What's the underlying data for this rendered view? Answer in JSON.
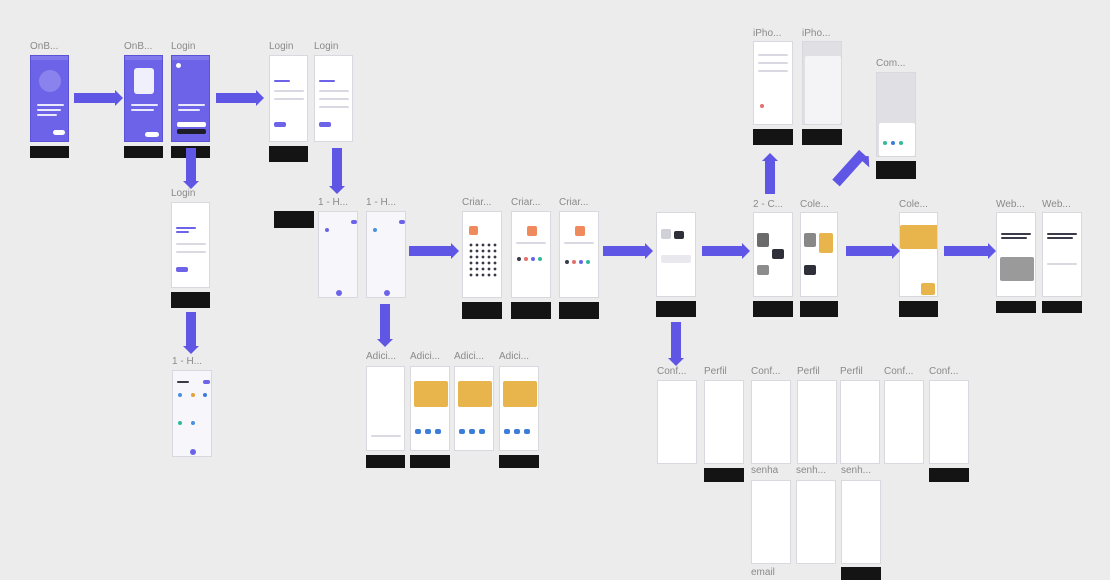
{
  "colors": {
    "background": "#ececec",
    "accent": "#6c63e9",
    "arrow": "#5f56e6",
    "note_bg": "#141414"
  },
  "frame_labels": {
    "onboarding_1": "OnB...",
    "onboarding_2": "OnB...",
    "login_1": "Login",
    "login_2": "Login",
    "login_3": "Login",
    "login_4": "Login",
    "home_a": "1 - H...",
    "home_b": "1 - H...",
    "home_c": "1 - H...",
    "criar_1": "Criar...",
    "criar_2": "Criar...",
    "criar_3": "Criar...",
    "adicionar_1": "Adici...",
    "adicionar_2": "Adici...",
    "adicionar_3": "Adici...",
    "adicionar_4": "Adici...",
    "iphone_1": "iPho...",
    "iphone_2": "iPho...",
    "com": "Com...",
    "c2": "2 - C...",
    "cole_1": "Cole...",
    "cole_2": "Cole...",
    "web_1": "Web...",
    "web_2": "Web...",
    "conf_1": "Conf...",
    "perfil_1": "Perfil",
    "conf_2": "Conf...",
    "perfil_2": "Perfil",
    "perfil_3": "Perfil",
    "conf_3": "Conf...",
    "conf_4": "Conf...",
    "senha_1": "senha",
    "senha_2": "senh...",
    "senha_3": "senh...",
    "email": "email"
  }
}
